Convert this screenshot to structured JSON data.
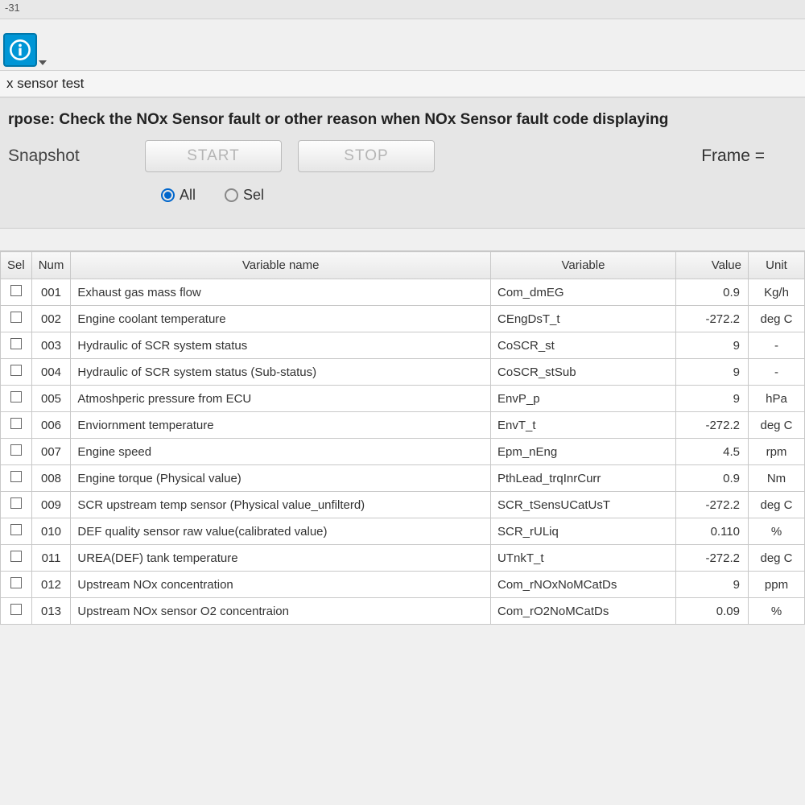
{
  "titlebar": "-31",
  "subtitle": "x sensor test",
  "purpose": "rpose: Check the NOx Sensor fault or other reason when NOx Sensor fault code displaying",
  "snapshot_label": "Snapshot",
  "buttons": {
    "start": "START",
    "stop": "STOP"
  },
  "frame_label": "Frame =",
  "radios": {
    "all": "All",
    "sel": "Sel",
    "selected": "all"
  },
  "columns": {
    "sel": "Sel",
    "num": "Num",
    "name": "Variable name",
    "var": "Variable",
    "val": "Value",
    "unit": "Unit"
  },
  "rows": [
    {
      "num": "001",
      "name": "Exhaust gas mass flow",
      "var": "Com_dmEG",
      "val": "0.9",
      "unit": "Kg/h"
    },
    {
      "num": "002",
      "name": "Engine coolant temperature",
      "var": "CEngDsT_t",
      "val": "-272.2",
      "unit": "deg C"
    },
    {
      "num": "003",
      "name": "Hydraulic of SCR system status",
      "var": "CoSCR_st",
      "val": "9",
      "unit": "-"
    },
    {
      "num": "004",
      "name": "Hydraulic of SCR system status (Sub-status)",
      "var": "CoSCR_stSub",
      "val": "9",
      "unit": "-"
    },
    {
      "num": "005",
      "name": "Atmoshperic pressure from ECU",
      "var": "EnvP_p",
      "val": "9",
      "unit": "hPa"
    },
    {
      "num": "006",
      "name": "Enviornment temperature",
      "var": "EnvT_t",
      "val": "-272.2",
      "unit": "deg C"
    },
    {
      "num": "007",
      "name": "Engine speed",
      "var": "Epm_nEng",
      "val": "4.5",
      "unit": "rpm"
    },
    {
      "num": "008",
      "name": "Engine torque (Physical value)",
      "var": "PthLead_trqInrCurr",
      "val": "0.9",
      "unit": "Nm"
    },
    {
      "num": "009",
      "name": "SCR upstream temp sensor (Physical value_unfilterd)",
      "var": "SCR_tSensUCatUsT",
      "val": "-272.2",
      "unit": "deg C"
    },
    {
      "num": "010",
      "name": "DEF quality sensor raw value(calibrated value)",
      "var": "SCR_rULiq",
      "val": "0.110",
      "unit": "%"
    },
    {
      "num": "011",
      "name": "UREA(DEF) tank temperature",
      "var": "UTnkT_t",
      "val": "-272.2",
      "unit": "deg C"
    },
    {
      "num": "012",
      "name": "Upstream NOx concentration",
      "var": "Com_rNOxNoMCatDs",
      "val": "9",
      "unit": "ppm"
    },
    {
      "num": "013",
      "name": "Upstream NOx sensor O2 concentraion",
      "var": "Com_rO2NoMCatDs",
      "val": "0.09",
      "unit": "%"
    }
  ]
}
